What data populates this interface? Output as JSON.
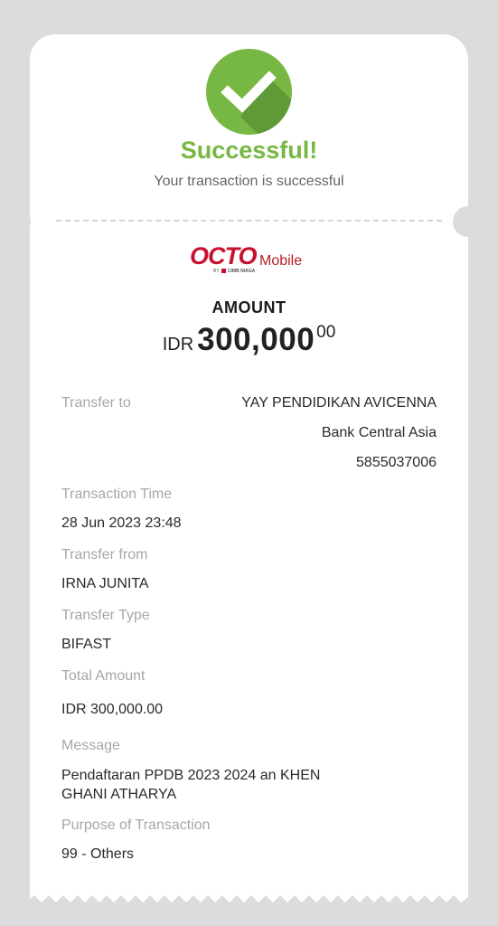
{
  "header": {
    "status_title": "Successful!",
    "status_subtitle": "Your transaction is successful",
    "status_color": "#76b843",
    "status_icon": "check-icon"
  },
  "brand": {
    "logo_text_octo": "OCTO",
    "logo_text_mobile": "Mobile",
    "logo_by": "BY",
    "logo_cimb": "CIMB NIAGA",
    "logo_color": "#c8102e"
  },
  "amount": {
    "label": "AMOUNT",
    "currency": "IDR",
    "integer": "300,000",
    "decimal": "00"
  },
  "details": {
    "transfer_to": {
      "label": "Transfer to",
      "name": "YAY PENDIDIKAN AVICENNA",
      "bank": "Bank Central Asia",
      "account": "5855037006"
    },
    "transaction_time": {
      "label": "Transaction Time",
      "value": "28 Jun 2023 23:48"
    },
    "transfer_from": {
      "label": "Transfer from",
      "value": "IRNA JUNITA"
    },
    "transfer_type": {
      "label": "Transfer Type",
      "value": "BIFAST"
    },
    "total_amount": {
      "label": "Total Amount",
      "value": "IDR 300,000.00"
    },
    "message": {
      "label": "Message",
      "line1": "Pendaftaran PPDB 2023 2024 an KHEN",
      "line2": "GHANI ATHARYA"
    },
    "purpose": {
      "label": "Purpose of Transaction",
      "value": "99 - Others"
    }
  }
}
